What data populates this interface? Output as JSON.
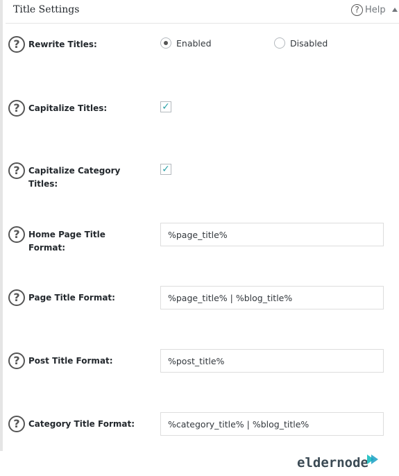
{
  "header": {
    "title": "Title Settings",
    "help_label": "Help"
  },
  "rows": [
    {
      "label": "Rewrite Titles:",
      "type": "radio",
      "options": [
        {
          "label": "Enabled",
          "checked": true
        },
        {
          "label": "Disabled",
          "checked": false
        }
      ]
    },
    {
      "label": "Capitalize Titles:",
      "type": "checkbox",
      "checked": true
    },
    {
      "label": "Capitalize Category Titles:",
      "type": "checkbox",
      "checked": true
    },
    {
      "label": "Home Page Title Format:",
      "type": "text",
      "value": "%page_title%"
    },
    {
      "label": "Page Title Format:",
      "type": "text",
      "value": "%page_title% | %blog_title%"
    },
    {
      "label": "Post Title Format:",
      "type": "text",
      "value": "%post_title%"
    },
    {
      "label": "Category Title Format:",
      "type": "text",
      "value": "%category_title% | %blog_title%"
    }
  ],
  "watermark": {
    "text": "eldernode"
  },
  "colors": {
    "checkmark": "#2ea2a8",
    "border": "#dddddd"
  }
}
